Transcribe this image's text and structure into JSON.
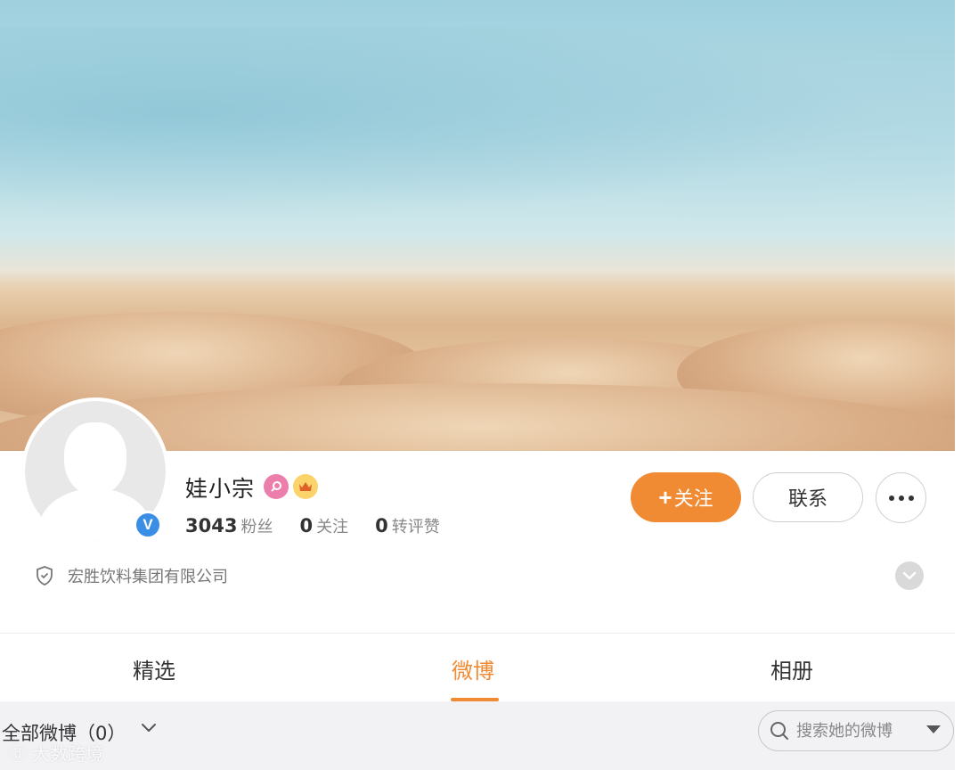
{
  "profile": {
    "name": "娃小宗",
    "verified_mark": "V",
    "badges": {
      "female_icon": "female-icon",
      "crown_icon": "crown-icon"
    },
    "stats": [
      {
        "value": "3043",
        "label": "粉丝"
      },
      {
        "value": "0",
        "label": "关注"
      },
      {
        "value": "0",
        "label": "转评赞"
      }
    ],
    "company": "宏胜饮料集团有限公司"
  },
  "actions": {
    "follow_plus": "+",
    "follow_label": "关注",
    "contact_label": "联系"
  },
  "tabs": [
    {
      "label": "精选",
      "active": false
    },
    {
      "label": "微博",
      "active": true
    },
    {
      "label": "相册",
      "active": false
    }
  ],
  "filter": {
    "label": "全部微博（0）",
    "search_placeholder": "搜索她的微博"
  },
  "watermark": {
    "logo": "ⓓ",
    "text": "大数跨境"
  },
  "colors": {
    "accent": "#f08a33",
    "verified": "#3a8ee6",
    "female_badge": "#ec7eac",
    "crown_badge": "#fbd36b"
  }
}
